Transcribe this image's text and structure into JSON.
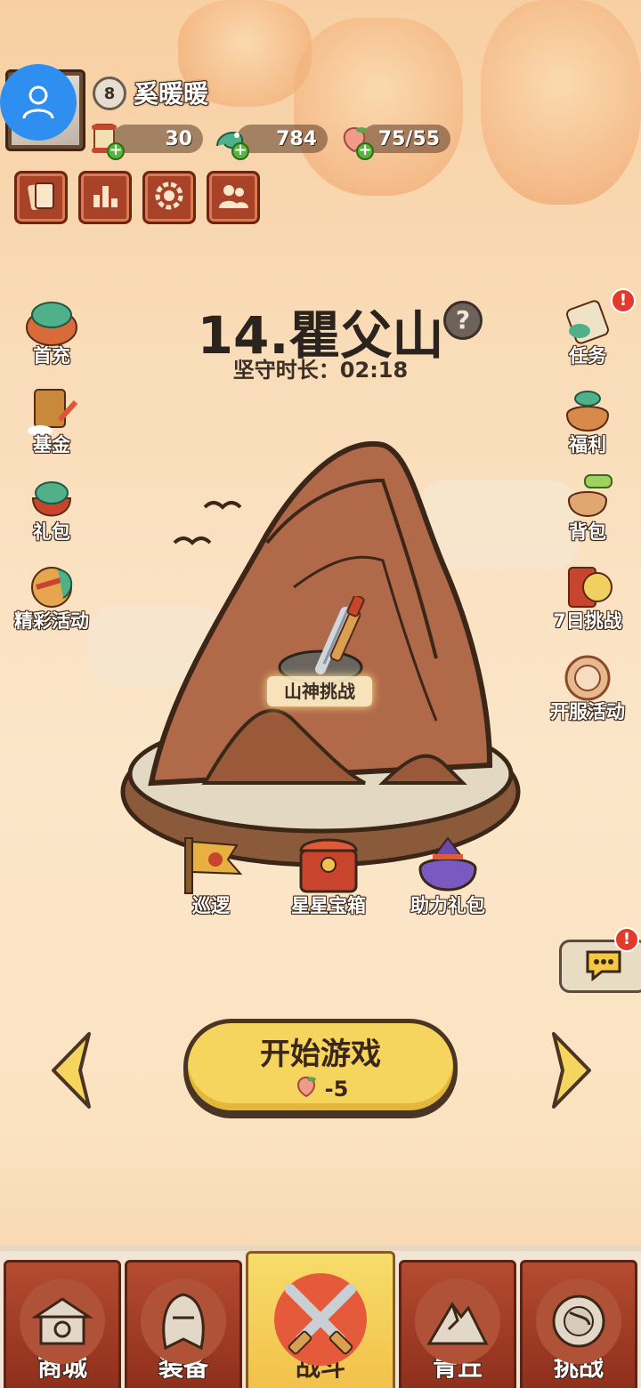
{
  "player": {
    "level": "8",
    "name": "奚暖暖"
  },
  "resources": [
    {
      "icon": "scroll-ticket-icon",
      "value": "30"
    },
    {
      "icon": "jade-dragon-icon",
      "value": "784"
    },
    {
      "icon": "peach-stamina-icon",
      "value": "75/55"
    }
  ],
  "quick_buttons": [
    {
      "icon": "cards-icon"
    },
    {
      "icon": "ranking-icon"
    },
    {
      "icon": "settings-gear-icon"
    },
    {
      "icon": "friends-icon"
    }
  ],
  "left_menu": [
    {
      "label": "首充",
      "icon": "first-recharge-icon"
    },
    {
      "label": "基金",
      "icon": "fund-icon"
    },
    {
      "label": "礼包",
      "icon": "gift-pack-icon"
    },
    {
      "label": "精彩活动",
      "icon": "events-icon"
    }
  ],
  "right_menu": [
    {
      "label": "任务",
      "icon": "task-scroll-icon",
      "alert": "!"
    },
    {
      "label": "福利",
      "icon": "welfare-bag-icon"
    },
    {
      "label": "背包",
      "icon": "backpack-icon"
    },
    {
      "label": "7日挑战",
      "icon": "seven-day-challenge-icon"
    },
    {
      "label": "开服活动",
      "icon": "server-open-event-icon"
    }
  ],
  "stage": {
    "title": "14.瞿父山",
    "help": "?",
    "hold_time": "坚守时长：02:18",
    "boss_label": "山神挑战"
  },
  "mid_buttons": [
    {
      "label": "巡逻",
      "icon": "patrol-flag-icon"
    },
    {
      "label": "星星宝箱",
      "icon": "star-chest-icon"
    },
    {
      "label": "助力礼包",
      "icon": "support-gift-bag-icon"
    }
  ],
  "start": {
    "label": "开始游戏",
    "cost": "-5"
  },
  "chat": {
    "alert": "!"
  },
  "bottom_nav": [
    {
      "label": "商城",
      "icon": "shop-icon",
      "active": false
    },
    {
      "label": "装备",
      "icon": "equipment-helmet-icon",
      "active": false
    },
    {
      "label": "战斗",
      "icon": "crossed-swords-icon",
      "active": true
    },
    {
      "label": "青丘",
      "icon": "qingqiu-mountain-icon",
      "active": false
    },
    {
      "label": "挑战",
      "icon": "challenge-orb-icon",
      "active": false
    }
  ],
  "colors": {
    "accent_red": "#a8432a",
    "start_yellow": "#f5d55e",
    "blue_avatar": "#2f8ff0"
  }
}
